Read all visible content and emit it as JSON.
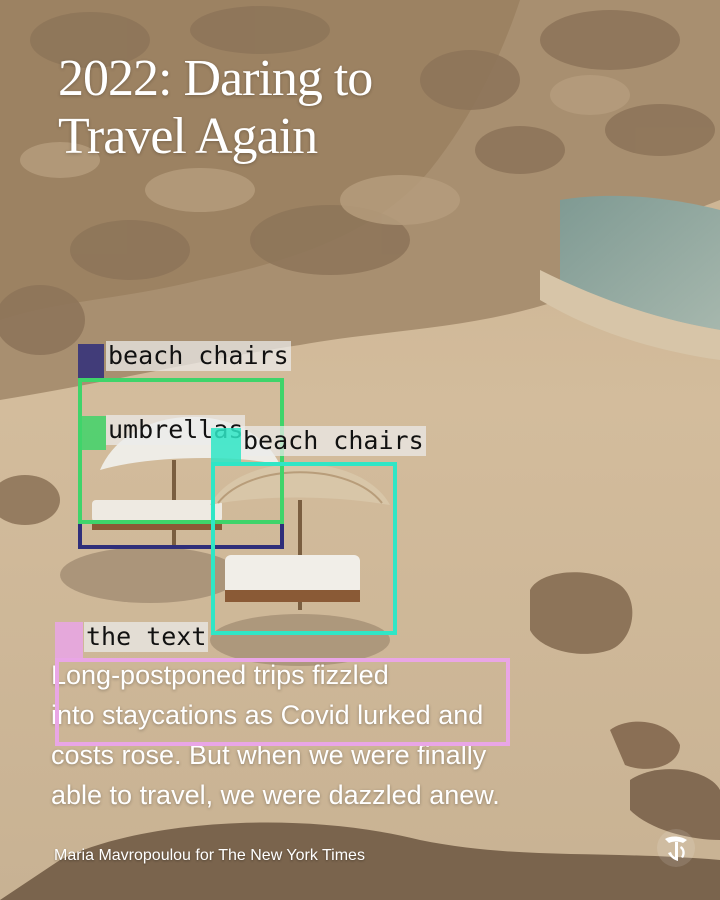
{
  "headline": {
    "line1": "2022: Daring to",
    "line2": "Travel Again"
  },
  "body": {
    "line1": "Long-postponed trips fizzled",
    "line2": "into staycations as Covid lurked and",
    "line3": "costs rose. But when we were finally",
    "line4": "able to travel, we were dazzled anew."
  },
  "credit": "Maria Mavropoulou for The New York Times",
  "logo": {
    "icon": "nyt-t-logo-icon"
  },
  "detections": [
    {
      "label": "beach chairs",
      "color": "#2f2e7a"
    },
    {
      "label": "umbrellas",
      "color": "#3fd46a"
    },
    {
      "label": "beach chairs",
      "color": "#2fe6c6"
    },
    {
      "label": "the text",
      "color": "#e9a6e6"
    }
  ]
}
